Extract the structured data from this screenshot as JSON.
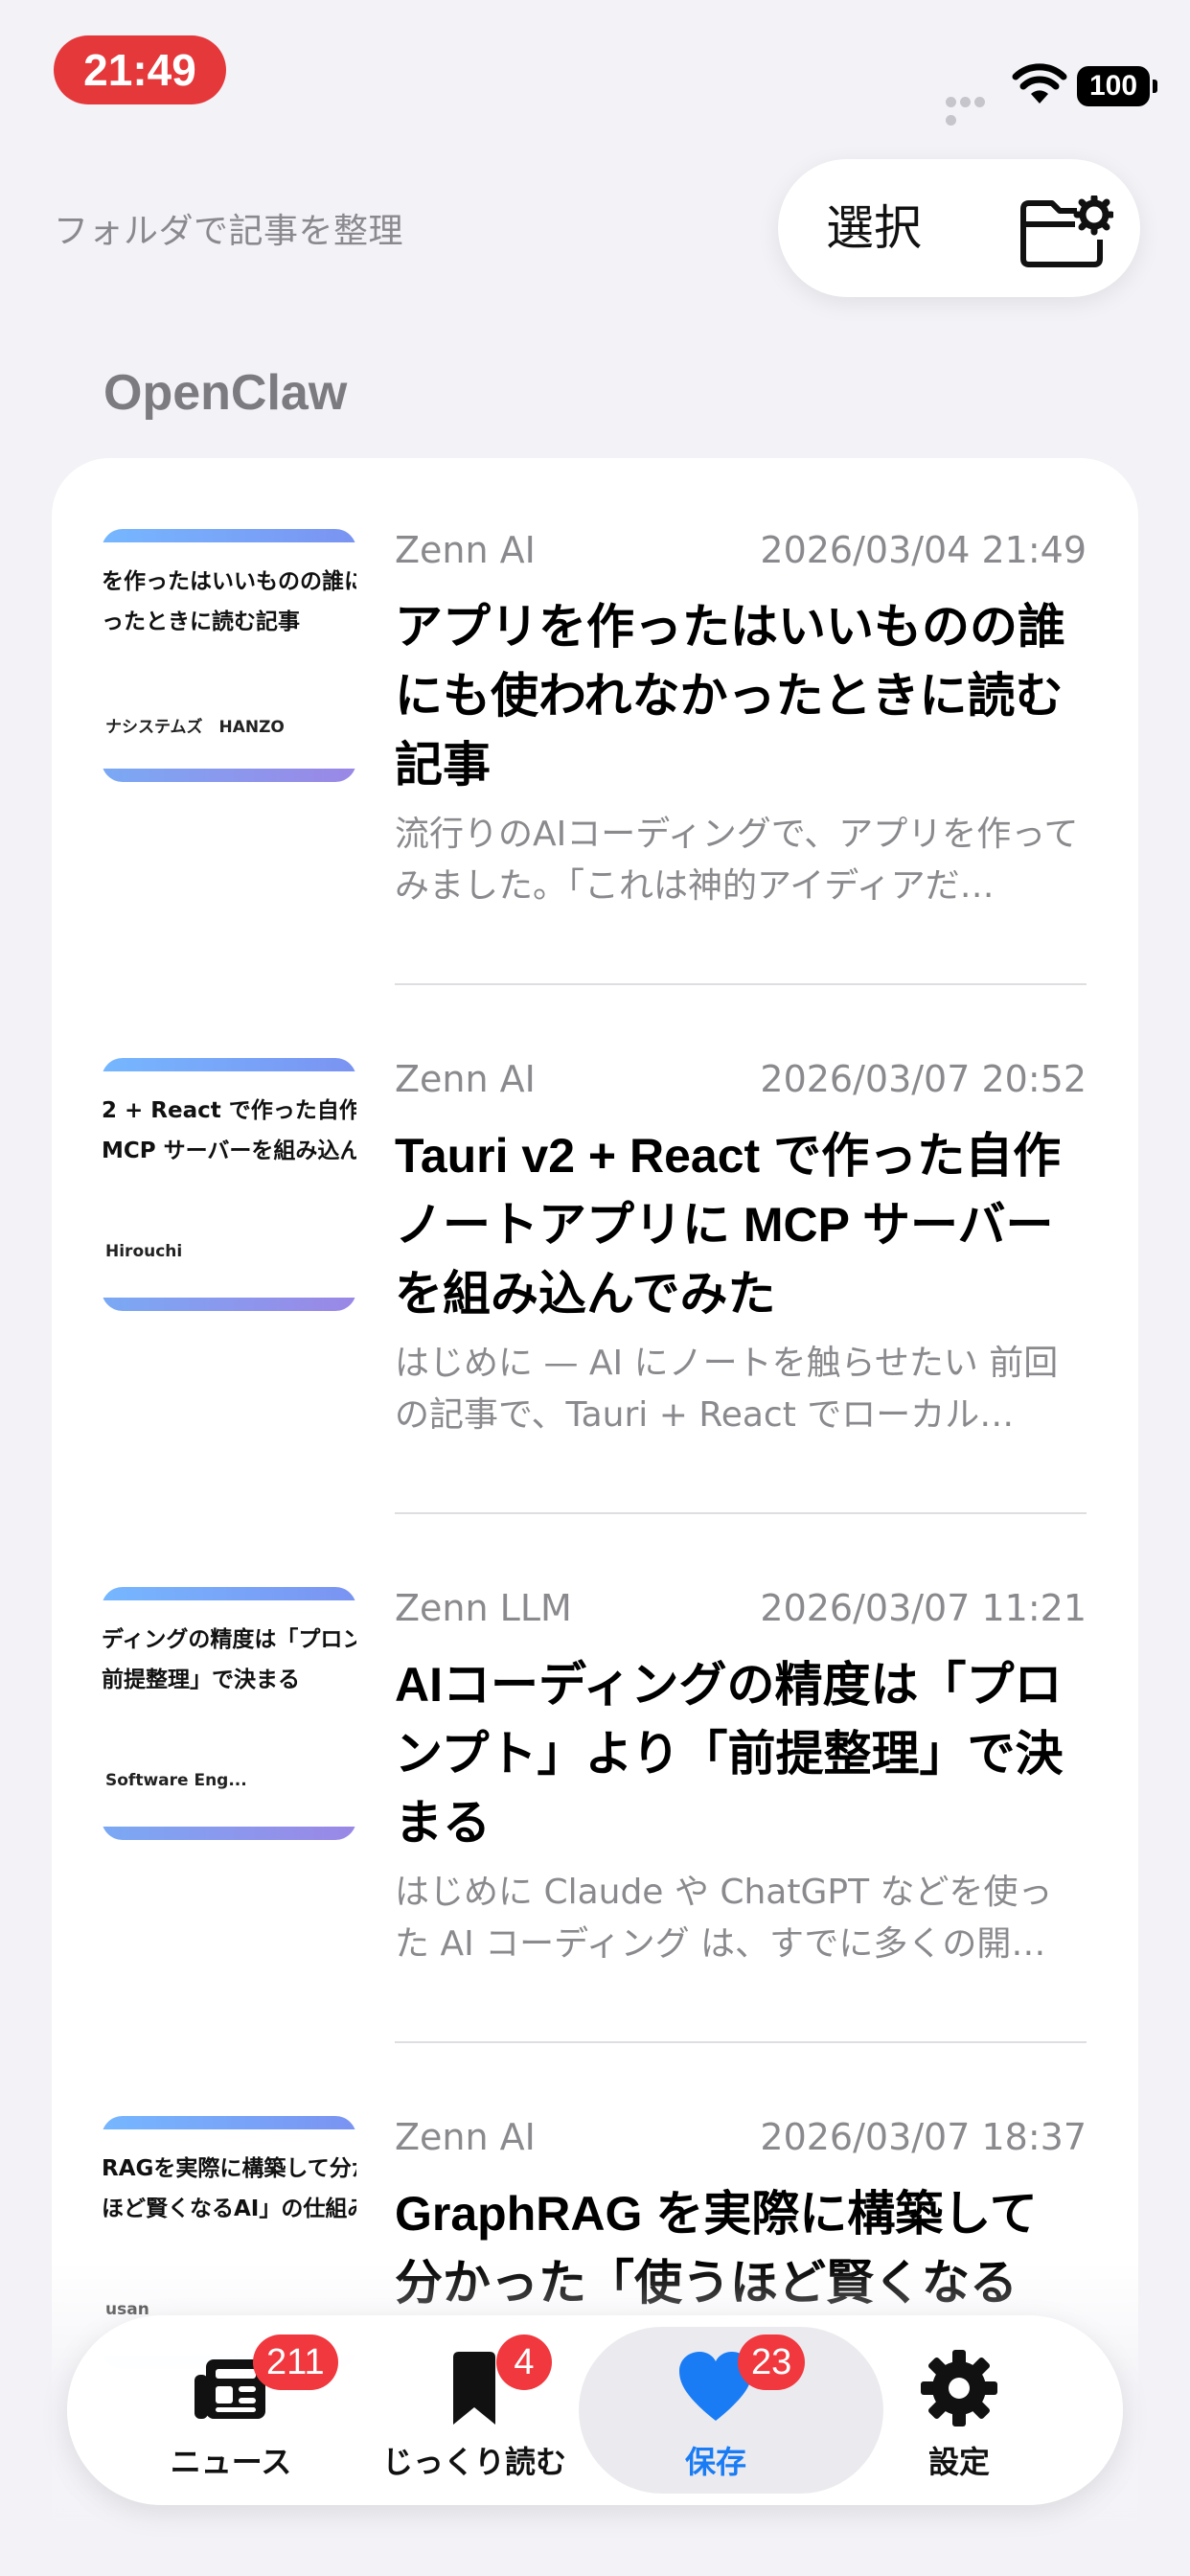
{
  "status_bar": {
    "time": "21:49",
    "battery": "100"
  },
  "header": {
    "subtitle": "フォルダで記事を整理",
    "select_label": "選択"
  },
  "section": {
    "title": "OpenClaw"
  },
  "articles": [
    {
      "thumb_title": "を作ったはいいものの誰にも\nったときに読む記事",
      "thumb_author": "ナシステムズ　HANZO",
      "source": "Zenn AI",
      "date": "2026/03/04 21:49",
      "title": "アプリを作ったはいいものの誰にも使われなかったときに読む記事",
      "excerpt": "流行りのAIコーディングで、アプリを作ってみました。「これは神的アイディアだ…"
    },
    {
      "thumb_title": "2 + React で作った自作ノー\nMCP サーバーを組み込んで",
      "thumb_author": "Hirouchi",
      "source": "Zenn AI",
      "date": "2026/03/07 20:52",
      "title": "Tauri v2 + React で作った自作ノートアプリに MCP サーバーを組み込んでみた",
      "excerpt": "はじめに — AI にノートを触らせたい 前回の記事で、Tauri + React でローカル…"
    },
    {
      "thumb_title": "ディングの精度は「プロンプ\n前提整理」で決まる",
      "thumb_author": "Software Eng...",
      "source": "Zenn LLM",
      "date": "2026/03/07 11:21",
      "title": "AIコーディングの精度は「プロンプト」より「前提整理」で決まる",
      "excerpt": "はじめに Claude や ChatGPT などを使った AI コーディング は、すでに多くの開…"
    },
    {
      "thumb_title": "RAGを実際に構築して分かっ\nほど賢くなるAI」の仕組み",
      "thumb_author": "usan",
      "source": "Zenn AI",
      "date": "2026/03/07 18:37",
      "title": "GraphRAG を実際に構築して分かった「使うほど賢くなる",
      "excerpt": ""
    }
  ],
  "tabs": [
    {
      "label": "ニュース",
      "badge": "211",
      "icon": "newspaper-icon"
    },
    {
      "label": "じっくり読む",
      "badge": "4",
      "icon": "bookmark-icon"
    },
    {
      "label": "保存",
      "badge": "23",
      "icon": "heart-icon",
      "active": true
    },
    {
      "label": "設定",
      "badge": "",
      "icon": "gear-icon"
    }
  ],
  "colors": {
    "accent": "#1a7cf5",
    "badge": "#f0383e",
    "time_pill": "#e5383b",
    "background": "#f2f2f7"
  }
}
